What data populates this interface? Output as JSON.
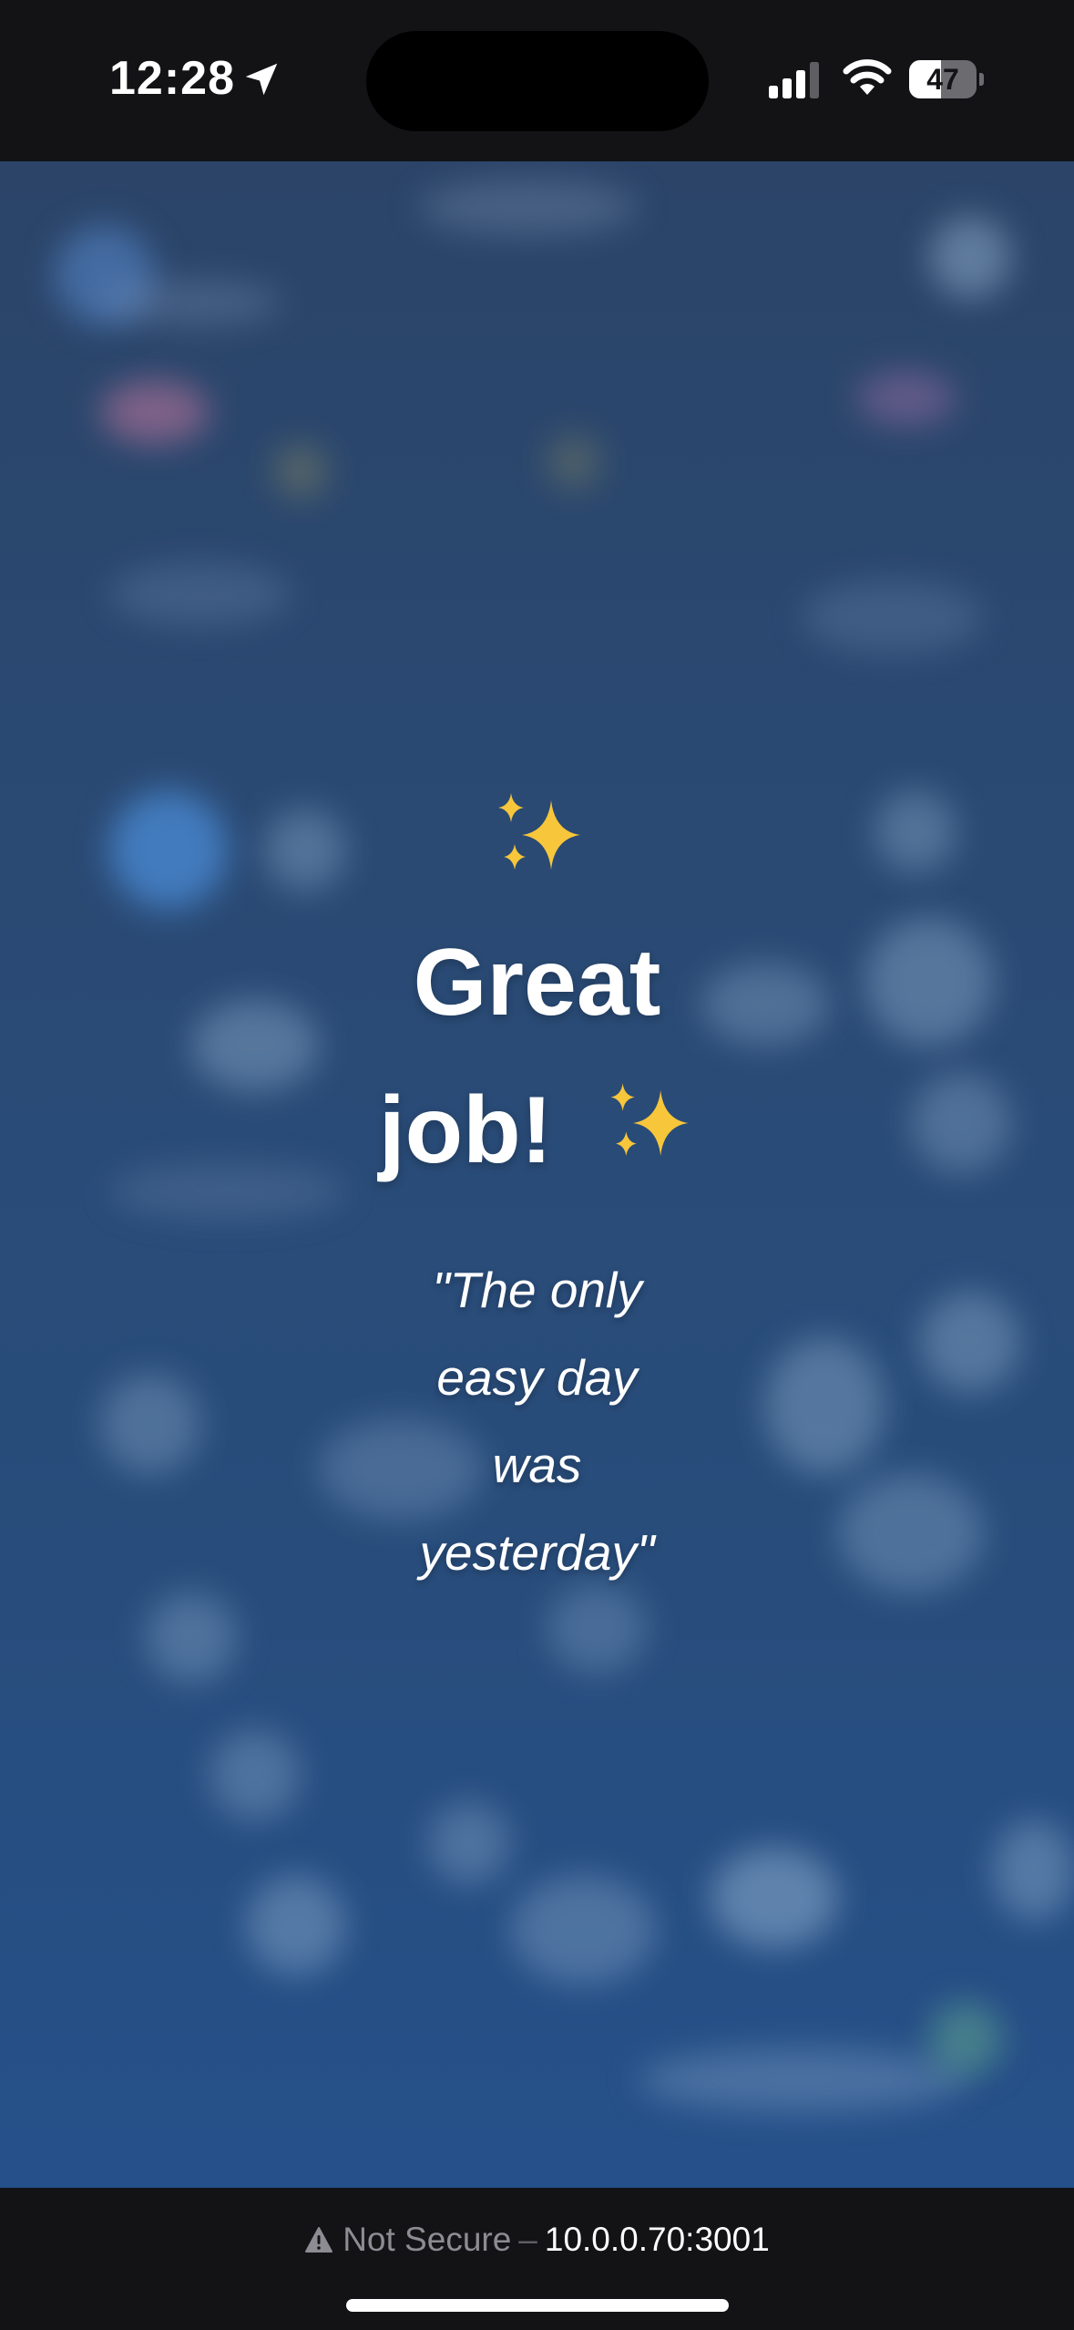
{
  "status_bar": {
    "time": "12:28",
    "battery": "47",
    "battery_level": 0.47
  },
  "celebration": {
    "sparkle_icon": "sparkles-emoji",
    "headline_line1": "Great",
    "headline_line2": "job!",
    "quote_lines": [
      "\"The only",
      "easy day",
      "was",
      "yesterday\""
    ]
  },
  "browser_bar": {
    "security_label": "Not Secure",
    "separator": "–",
    "url": "10.0.0.70:3001"
  },
  "colors": {
    "background_top": "#2b4468",
    "background_bottom": "#25508a",
    "chrome": "#131316",
    "sparkle_gold": "#f7c63a"
  }
}
